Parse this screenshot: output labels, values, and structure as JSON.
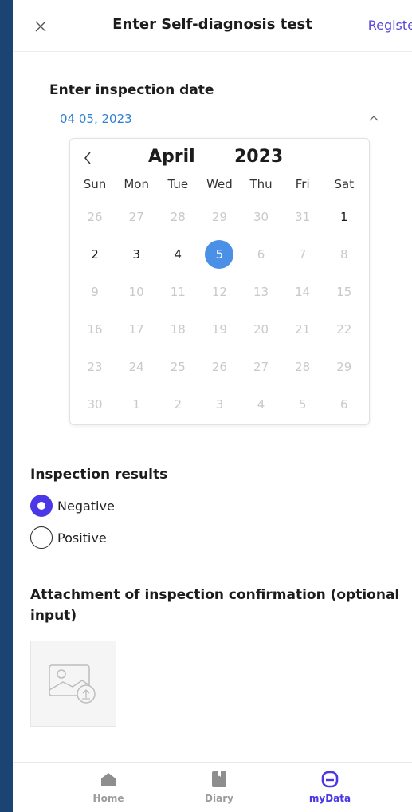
{
  "header": {
    "title": "Enter Self-diagnosis test",
    "register_label": "Registe"
  },
  "inspection_date": {
    "label": "Enter inspection date",
    "value": "04 05, 2023"
  },
  "calendar": {
    "month": "April",
    "year": "2023",
    "weekdays": [
      "Sun",
      "Mon",
      "Tue",
      "Wed",
      "Thu",
      "Fri",
      "Sat"
    ],
    "days": [
      {
        "d": "26",
        "state": "muted"
      },
      {
        "d": "27",
        "state": "muted"
      },
      {
        "d": "28",
        "state": "muted"
      },
      {
        "d": "29",
        "state": "muted"
      },
      {
        "d": "30",
        "state": "muted"
      },
      {
        "d": "31",
        "state": "muted"
      },
      {
        "d": "1",
        "state": "active"
      },
      {
        "d": "2",
        "state": "active"
      },
      {
        "d": "3",
        "state": "active"
      },
      {
        "d": "4",
        "state": "active"
      },
      {
        "d": "5",
        "state": "selected"
      },
      {
        "d": "6",
        "state": "muted"
      },
      {
        "d": "7",
        "state": "muted"
      },
      {
        "d": "8",
        "state": "muted"
      },
      {
        "d": "9",
        "state": "muted"
      },
      {
        "d": "10",
        "state": "muted"
      },
      {
        "d": "11",
        "state": "muted"
      },
      {
        "d": "12",
        "state": "muted"
      },
      {
        "d": "13",
        "state": "muted"
      },
      {
        "d": "14",
        "state": "muted"
      },
      {
        "d": "15",
        "state": "muted"
      },
      {
        "d": "16",
        "state": "muted"
      },
      {
        "d": "17",
        "state": "muted"
      },
      {
        "d": "18",
        "state": "muted"
      },
      {
        "d": "19",
        "state": "muted"
      },
      {
        "d": "20",
        "state": "muted"
      },
      {
        "d": "21",
        "state": "muted"
      },
      {
        "d": "22",
        "state": "muted"
      },
      {
        "d": "23",
        "state": "muted"
      },
      {
        "d": "24",
        "state": "muted"
      },
      {
        "d": "25",
        "state": "muted"
      },
      {
        "d": "26",
        "state": "muted"
      },
      {
        "d": "27",
        "state": "muted"
      },
      {
        "d": "28",
        "state": "muted"
      },
      {
        "d": "29",
        "state": "muted"
      },
      {
        "d": "30",
        "state": "muted"
      },
      {
        "d": "1",
        "state": "muted"
      },
      {
        "d": "2",
        "state": "muted"
      },
      {
        "d": "3",
        "state": "muted"
      },
      {
        "d": "4",
        "state": "muted"
      },
      {
        "d": "5",
        "state": "muted"
      },
      {
        "d": "6",
        "state": "muted"
      }
    ]
  },
  "results": {
    "label": "Inspection results",
    "options": [
      {
        "label": "Negative",
        "checked": true
      },
      {
        "label": "Positive",
        "checked": false
      }
    ]
  },
  "attachment": {
    "label": "Attachment of inspection confirmation (optional input)"
  },
  "bottom_nav": [
    {
      "label": "Home",
      "icon": "home-icon",
      "active": false
    },
    {
      "label": "Diary",
      "icon": "diary-icon",
      "active": false
    },
    {
      "label": "myData",
      "icon": "mydata-icon",
      "active": true
    }
  ],
  "colors": {
    "accent": "#4a37e6",
    "selected_day": "#4a90e6",
    "date_text": "#2f7fd0",
    "background_frame": "#1b4472"
  }
}
